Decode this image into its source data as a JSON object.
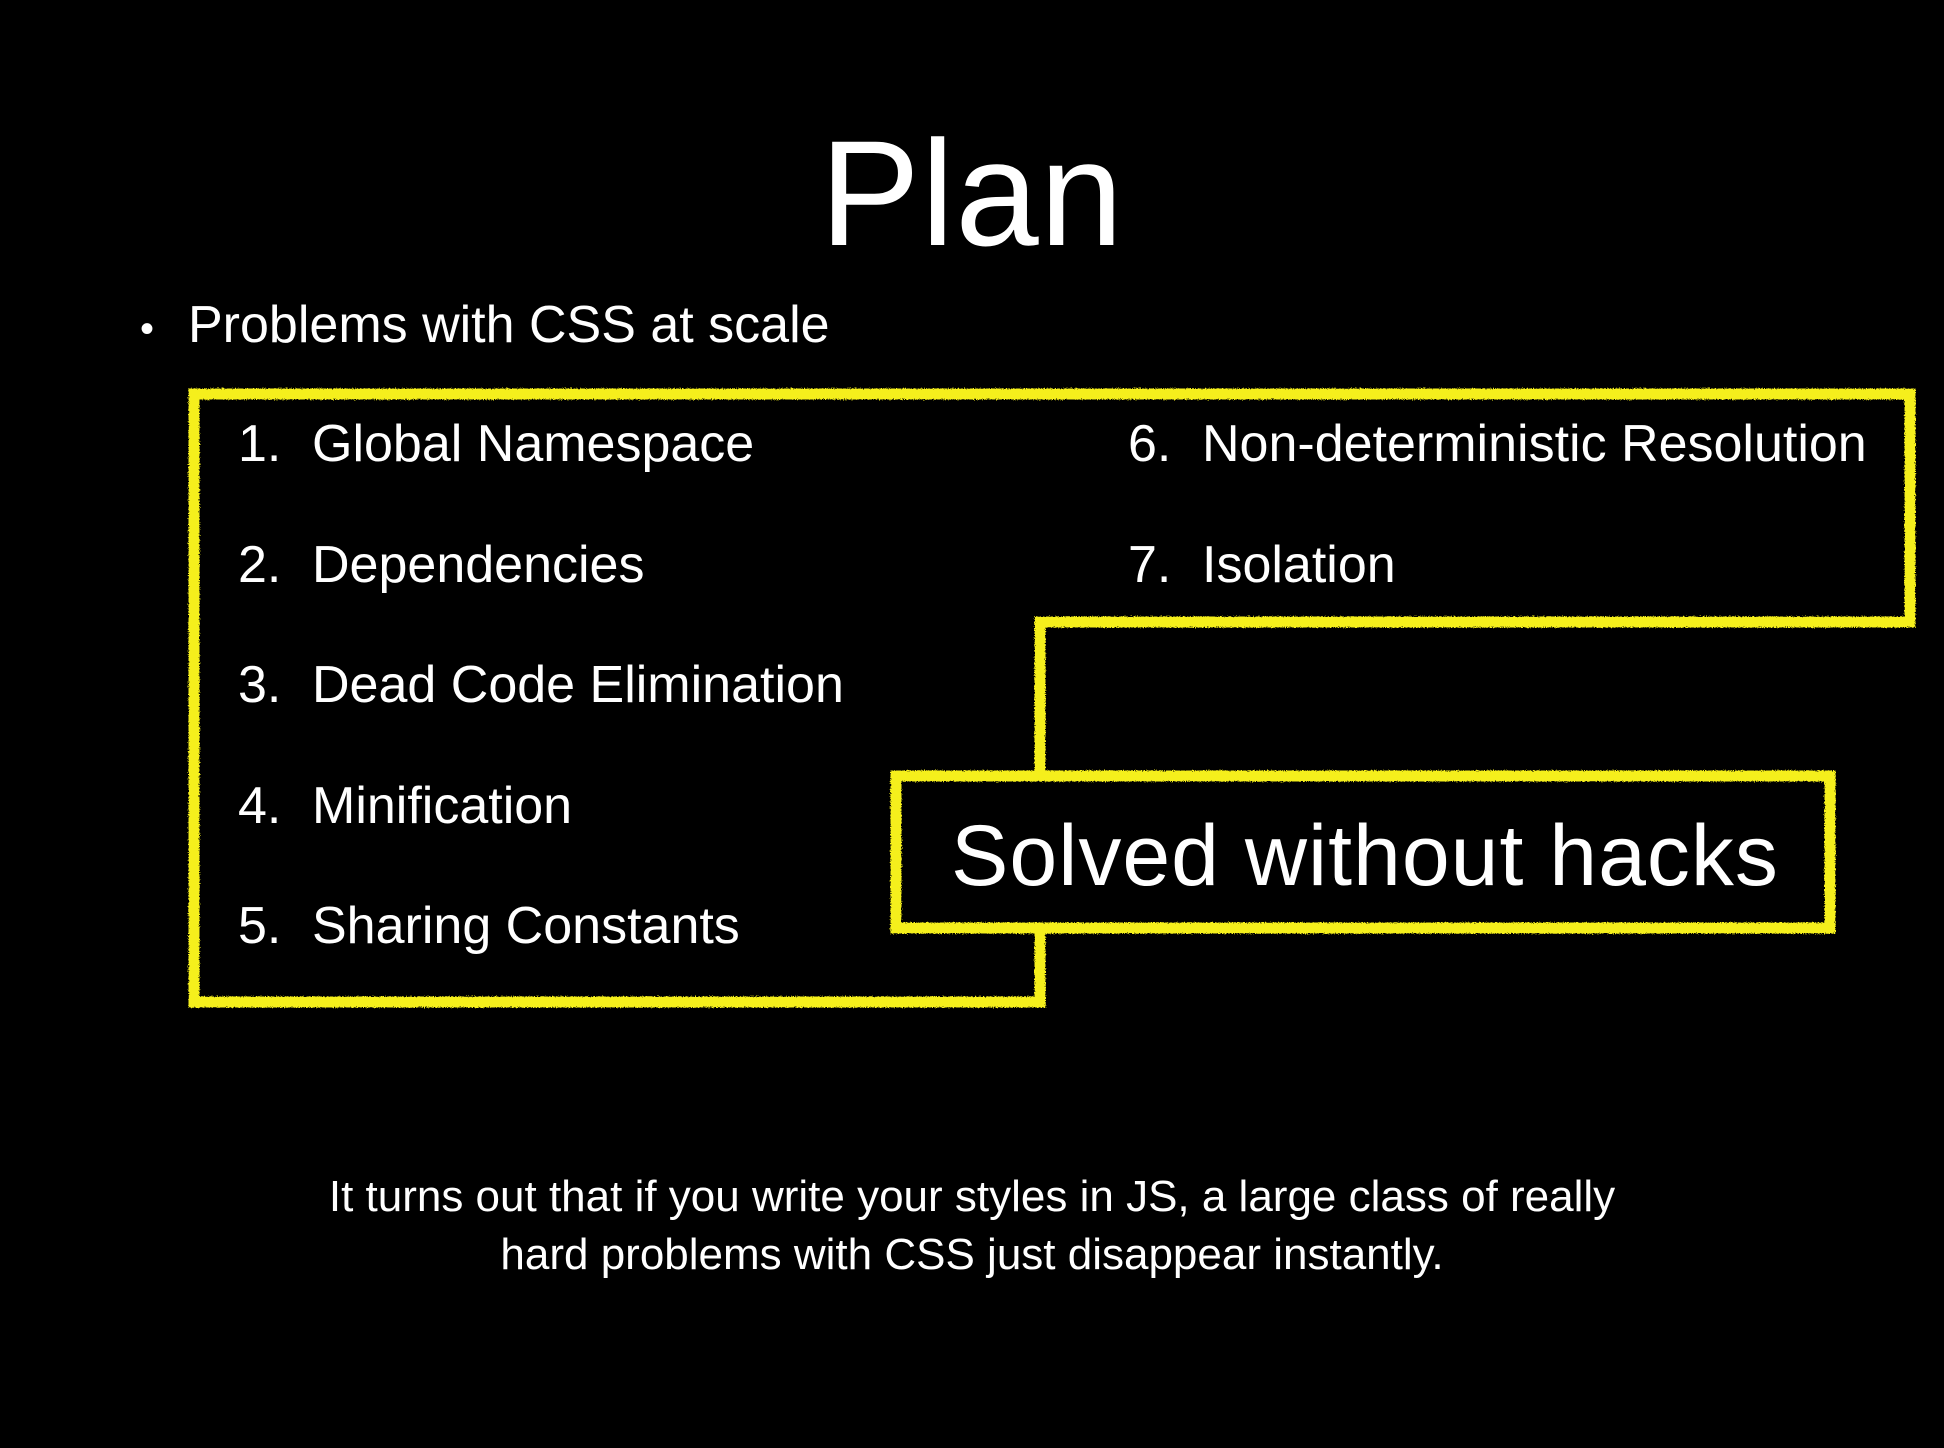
{
  "slide": {
    "title": "Plan",
    "bullet": {
      "marker": "•",
      "text": "Problems with CSS at scale"
    },
    "problems": [
      {
        "number": "1.",
        "label": "Global Namespace"
      },
      {
        "number": "2.",
        "label": "Dependencies"
      },
      {
        "number": "3.",
        "label": "Dead Code Elimination"
      },
      {
        "number": "4.",
        "label": "Minification"
      },
      {
        "number": "5.",
        "label": "Sharing Constants"
      },
      {
        "number": "6.",
        "label": "Non-deterministic Resolution"
      },
      {
        "number": "7.",
        "label": "Isolation"
      }
    ],
    "callout": "Solved without hacks",
    "footer": {
      "line1": "It turns out that if you write your styles in JS, a large class of really",
      "line2": "hard problems with CSS just disappear instantly."
    },
    "colors": {
      "background": "#000000",
      "text": "#ffffff",
      "highlight": "#f5ef1f"
    }
  }
}
